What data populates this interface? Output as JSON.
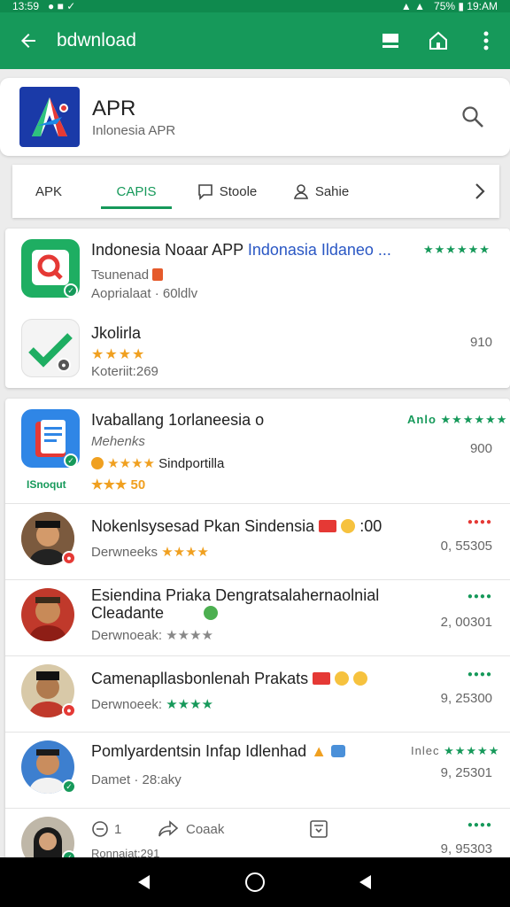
{
  "status": {
    "left": "13:59",
    "right": "75% ▮ 19:AM"
  },
  "appbar": {
    "title": "bdwnload"
  },
  "header": {
    "title": "APR",
    "subtitle": "Inlonesia  APR"
  },
  "tabs": [
    {
      "label": "APK"
    },
    {
      "label": "CAPIS"
    },
    {
      "label": "Stoole"
    },
    {
      "label": "Sahie"
    }
  ],
  "card1": {
    "item1": {
      "title": "Indonesia Noaar APP",
      "title_link": "Indonasia  Ildaneo ...",
      "line2": "Tsunenad",
      "line3": "Aoprialaat · 60ldlv",
      "stars": "★★★★★★"
    },
    "item2": {
      "title": "Jkolirla",
      "stars": "★★★★",
      "line3": "Koteriit:269",
      "number": "910"
    }
  },
  "list": {
    "item1": {
      "title": "Ivaballang 1orlaneesia o",
      "line2": "Mehenks",
      "line3": "Sindportilla",
      "extra": "★★★ 50",
      "icon_caption": "ISnoqut",
      "right_label": "Anlo",
      "stars": "★★★★★★",
      "number": "900"
    },
    "item2": {
      "title": "Nokenlsysesad  Pkan Sindensia",
      "title_suffix": ":00",
      "sub": "Derwneeks",
      "stars": "★★★★",
      "number": "0, 55305"
    },
    "item3": {
      "title": "Esiendina Priaka Dengratsalahernaolnial",
      "title2": "Cleadante",
      "sub": "Derwnoeak:",
      "stars": "★★★★",
      "number": "2, 00301"
    },
    "item4": {
      "title": "Camenapllasbonlenah Prakats",
      "sub": "Derwnoeek:",
      "stars": "★★★★",
      "number": "9, 25300"
    },
    "item5": {
      "title": "Pomlyardentsin Infap Idlenhad",
      "sub": "Damet · 28:aky",
      "right_label": "Inlec",
      "stars": "★★★★★",
      "number": "9, 25301"
    },
    "item6": {
      "sub": "Ronnaiat:291",
      "number": "9, 95303",
      "comment_count": "1",
      "action_label": "Coaak"
    }
  }
}
